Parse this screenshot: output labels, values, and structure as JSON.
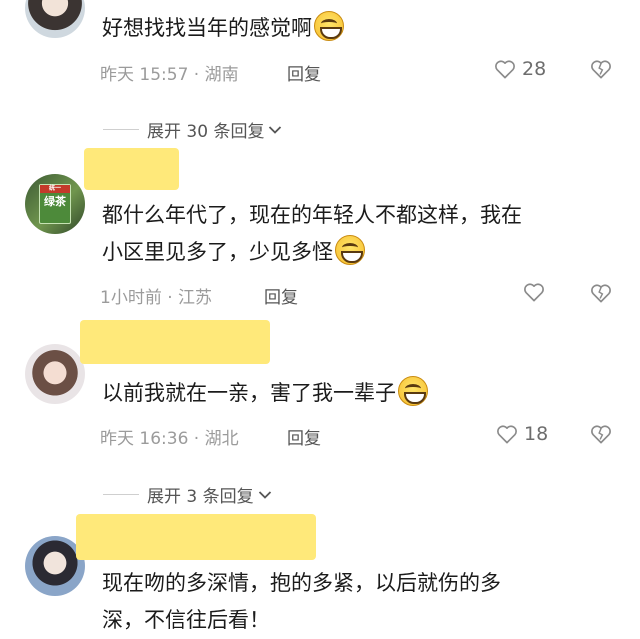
{
  "comments": [
    {
      "text": "好想找找当年的感觉啊",
      "time": "昨天 15:57 · 湖南",
      "reply_label": "回复",
      "likes": "28",
      "emoji": "grinning-emoji"
    },
    {
      "text_line1": "都什么年代了，现在的年轻人不都这样，我在",
      "text_line2": "小区里见多了，少见多怪",
      "time": "1小时前 · 江苏",
      "reply_label": "回复",
      "likes": "",
      "emoji": "laughing-tears-emoji",
      "avatar_tag": "绿茶",
      "avatar_tag_small": "统一"
    },
    {
      "text": "以前我就在一亲，害了我一辈子",
      "time": "昨天 16:36 · 湖北",
      "reply_label": "回复",
      "likes": "18",
      "emoji": "laughing-tears-emoji"
    },
    {
      "text_line1": "现在吻的多深情，抱的多紧，以后就伤的多",
      "text_line2": "深，不信往后看！"
    }
  ],
  "expand_replies": [
    {
      "label": "展开 30 条回复"
    },
    {
      "label": "展开 3 条回复"
    }
  ],
  "colors": {
    "scribble": "#ffe97a",
    "meta_text": "#9b9b9b",
    "body_text": "#1b1b1b"
  }
}
